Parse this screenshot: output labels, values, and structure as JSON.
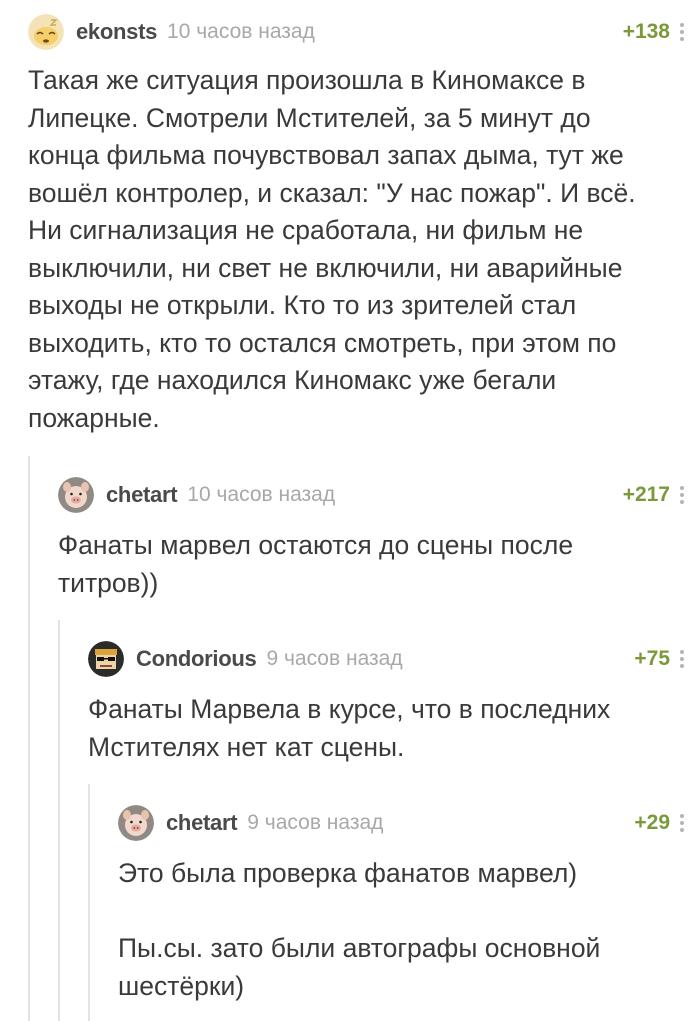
{
  "comments": [
    {
      "username": "ekonsts",
      "time": "10 часов назад",
      "rating": "+138",
      "avatar_icon": "sleeping-face-avatar",
      "text": "Такая же ситуация произошла в Киномаксе в Липецке. Смотрели Мстителей, за 5 минут до конца фильма почувствовал запах дыма, тут же вошёл контролер, и сказал: \"У нас пожар\". И всё. Ни сигнализация не сработала, ни фильм не выключили, ни свет не включили, ни аварийные выходы не открыли. Кто то из зрителей стал выходить, кто то остался смотреть, при этом по этажу, где находился Киномакс уже бегали пожарные."
    },
    {
      "username": "chetart",
      "time": "10 часов назад",
      "rating": "+217",
      "avatar_icon": "pig-avatar",
      "text": "Фанаты марвел остаются до сцены после титров))"
    },
    {
      "username": "Condorious",
      "time": "9 часов назад",
      "rating": "+75",
      "avatar_icon": "pixel-face-avatar",
      "text": "Фанаты Марвела в курсе, что в последних Мстителях нет кат сцены."
    },
    {
      "username": "chetart",
      "time": "9 часов назад",
      "rating": "+29",
      "avatar_icon": "pig-avatar",
      "text": "Это была проверка фанатов марвел)\n\nПы.сы. зато были автографы основной шестёрки)"
    }
  ],
  "colors": {
    "rating_green": "#7a9a3a",
    "time_gray": "#a8a8a8",
    "text_dark": "#3a3a3a",
    "thread_line": "#e2e2e2"
  }
}
